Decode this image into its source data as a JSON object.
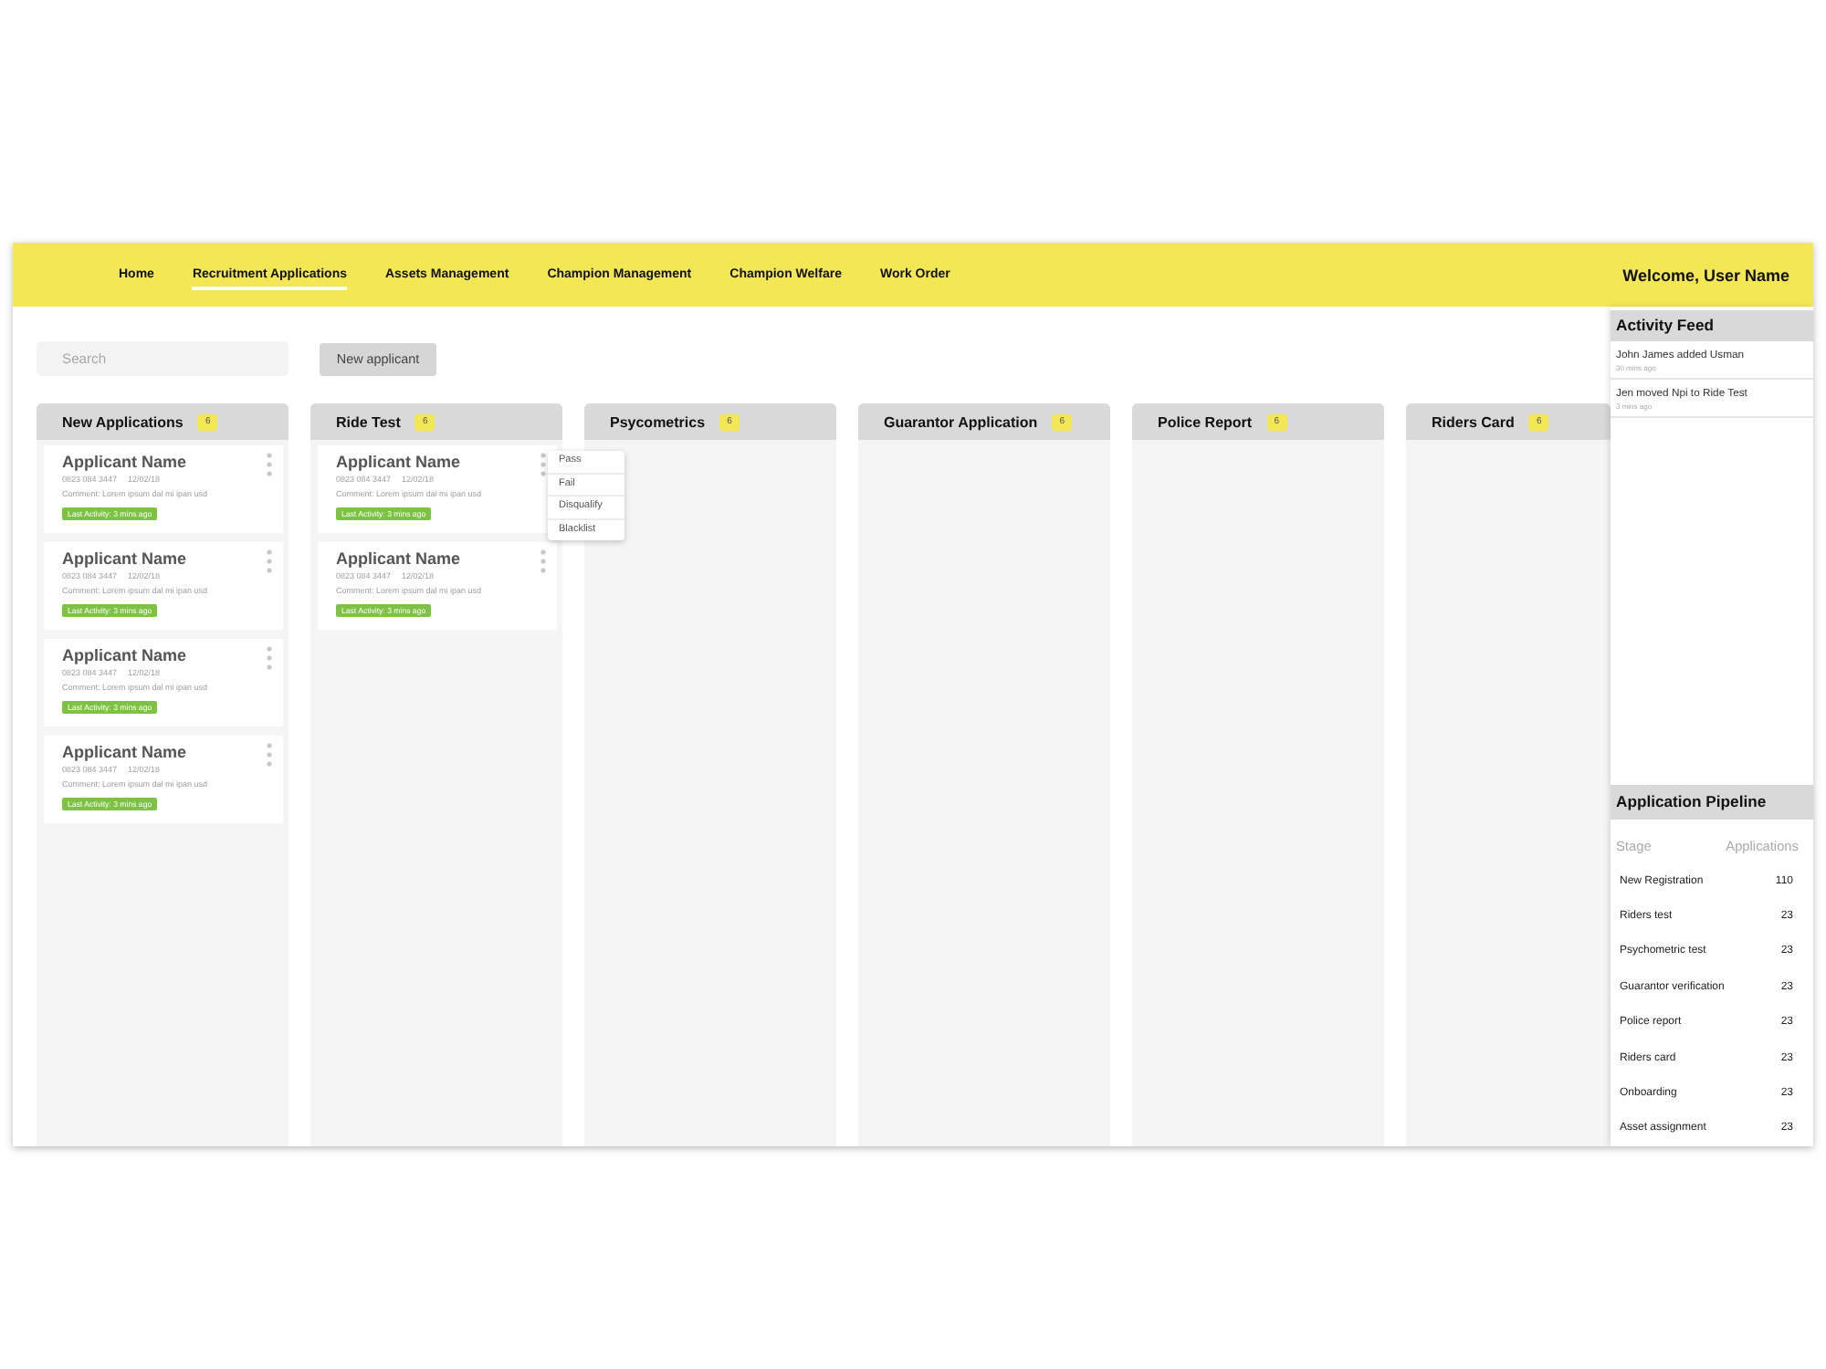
{
  "nav": {
    "items": [
      {
        "label": "Home",
        "selected": false
      },
      {
        "label": "Recruitment Applications",
        "selected": true
      },
      {
        "label": "Assets Management",
        "selected": false
      },
      {
        "label": "Champion Management",
        "selected": false
      },
      {
        "label": "Champion Welfare",
        "selected": false
      },
      {
        "label": "Work Order",
        "selected": false
      }
    ],
    "welcome": "Welcome, User Name"
  },
  "toolbar": {
    "search": {
      "placeholder": "Search"
    },
    "new_button": "New applicant"
  },
  "columns": [
    {
      "title": "New Applications",
      "count": "6",
      "cards": [
        {
          "name": "Applicant Name",
          "phone": "0823 084 3447",
          "date": "12/02/18",
          "comment": "Comment: Lorem ipsum dal mi ipan usd",
          "activity": "Last Activity: 3 mins ago"
        },
        {
          "name": "Applicant Name",
          "phone": "0823 084 3447",
          "date": "12/02/18",
          "comment": "Comment: Lorem ipsum dal mi ipan usd",
          "activity": "Last Activity: 3 mins ago"
        },
        {
          "name": "Applicant Name",
          "phone": "0823 084 3447",
          "date": "12/02/18",
          "comment": "Comment: Lorem ipsum dal mi ipan usd",
          "activity": "Last Activity: 3 mins ago"
        },
        {
          "name": "Applicant Name",
          "phone": "0823 084 3447",
          "date": "12/02/18",
          "comment": "Comment: Lorem ipsum dal mi ipan usd",
          "activity": "Last Activity: 3 mins ago"
        }
      ]
    },
    {
      "title": "Ride Test",
      "count": "6",
      "cards": [
        {
          "name": "Applicant Name",
          "phone": "0823 084 3447",
          "date": "12/02/18",
          "comment": "Comment: Lorem ipsum dal mi ipan usd",
          "activity": "Last Activity: 3 mins ago",
          "menu": [
            "Pass",
            "Fail",
            "Disqualify",
            "Blacklist"
          ]
        },
        {
          "name": "Applicant Name",
          "phone": "0823 084 3447",
          "date": "12/02/18",
          "comment": "Comment: Lorem ipsum dal mi ipan usd",
          "activity": "Last Activity: 3 mins ago"
        }
      ]
    },
    {
      "title": "Psycometrics",
      "count": "6"
    },
    {
      "title": "Guarantor Application",
      "count": "6"
    },
    {
      "title": "Police Report",
      "count": "6"
    },
    {
      "title": "Riders Card",
      "count": "6"
    }
  ],
  "activity_feed": {
    "title": "Activity Feed",
    "items": [
      {
        "text": "John James added Usman",
        "time": "30 mins ago"
      },
      {
        "text": "Jen moved Npi to Ride Test",
        "time": "3 mins ago"
      }
    ]
  },
  "pipeline": {
    "title": "Application Pipeline",
    "headers": [
      "Stage",
      "Applications"
    ],
    "rows": [
      {
        "stage": "New Registration",
        "count": "110"
      },
      {
        "stage": "Riders test",
        "count": "23"
      },
      {
        "stage": "Psychometric test",
        "count": "23"
      },
      {
        "stage": "Guarantor verification",
        "count": "23"
      },
      {
        "stage": "Police report",
        "count": "23"
      },
      {
        "stage": "Riders card",
        "count": "23"
      },
      {
        "stage": "Onboarding",
        "count": "23"
      },
      {
        "stage": "Asset assignment",
        "count": "23"
      }
    ]
  }
}
